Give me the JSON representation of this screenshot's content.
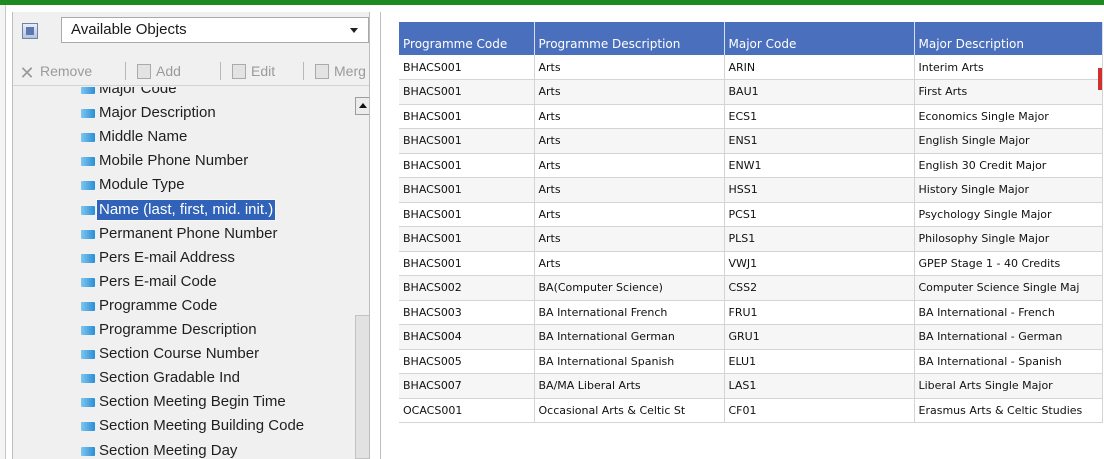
{
  "object_selector": {
    "value": "Available Objects"
  },
  "toolbar": {
    "remove_label": "Remove",
    "add_label": "Add",
    "edit_label": "Edit",
    "merge_label": "Merg"
  },
  "fields": {
    "items": [
      {
        "label": "Major Code"
      },
      {
        "label": "Major Description"
      },
      {
        "label": "Middle Name"
      },
      {
        "label": "Mobile Phone Number"
      },
      {
        "label": "Module Type"
      },
      {
        "label": "Name (last, first, mid. init.)",
        "selected": true
      },
      {
        "label": "Permanent Phone Number"
      },
      {
        "label": "Pers E-mail Address"
      },
      {
        "label": "Pers E-mail Code"
      },
      {
        "label": "Programme Code"
      },
      {
        "label": "Programme Description"
      },
      {
        "label": "Section Course Number"
      },
      {
        "label": "Section Gradable Ind"
      },
      {
        "label": "Section Meeting Begin Time"
      },
      {
        "label": "Section Meeting Building Code"
      },
      {
        "label": "Section Meeting Day"
      }
    ]
  },
  "table": {
    "columns": [
      "Programme Code",
      "Programme Description",
      "Major Code",
      "Major Description"
    ],
    "rows": [
      [
        "BHACS001",
        "Arts",
        "ARIN",
        "Interim Arts"
      ],
      [
        "BHACS001",
        "Arts",
        "BAU1",
        "First Arts"
      ],
      [
        "BHACS001",
        "Arts",
        "ECS1",
        "Economics Single Major"
      ],
      [
        "BHACS001",
        "Arts",
        "ENS1",
        "English Single Major"
      ],
      [
        "BHACS001",
        "Arts",
        "ENW1",
        "English  30 Credit Major"
      ],
      [
        "BHACS001",
        "Arts",
        "HSS1",
        "History Single Major"
      ],
      [
        "BHACS001",
        "Arts",
        "PCS1",
        "Psychology Single Major"
      ],
      [
        "BHACS001",
        "Arts",
        "PLS1",
        "Philosophy Single Major"
      ],
      [
        "BHACS001",
        "Arts",
        "VWJ1",
        "GPEP Stage 1 - 40 Credits"
      ],
      [
        "BHACS002",
        "BA(Computer Science)",
        "CSS2",
        "Computer Science Single Maj"
      ],
      [
        "BHACS003",
        "BA International French",
        "FRU1",
        "BA International - French"
      ],
      [
        "BHACS004",
        "BA International German",
        "GRU1",
        "BA International - German"
      ],
      [
        "BHACS005",
        "BA International Spanish",
        "ELU1",
        "BA International - Spanish"
      ],
      [
        "BHACS007",
        "BA/MA Liberal Arts",
        "LAS1",
        "Liberal Arts Single Major"
      ],
      [
        "OCACS001",
        "Occasional Arts & Celtic St",
        "CF01",
        "Erasmus Arts & Celtic Studies"
      ]
    ]
  },
  "colors": {
    "header_blue": "#4a6fbd",
    "selection_blue": "#2f62b8",
    "top_border_green": "#1f8a1f",
    "field_icon_blue": "#2a8fd6"
  }
}
